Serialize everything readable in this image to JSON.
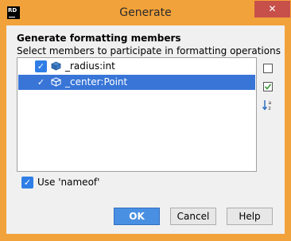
{
  "window": {
    "title": "Generate",
    "app_icon_text": "RD",
    "close_glyph": "✕"
  },
  "dialog": {
    "heading": "Generate formatting members",
    "instruction": "Select members to participate in formatting operations"
  },
  "members": [
    {
      "name": "_radius:int",
      "checked": true,
      "selected": false,
      "icon": "field-icon"
    },
    {
      "name": "_center:Point",
      "checked": true,
      "selected": true,
      "icon": "field-icon"
    }
  ],
  "side_actions": [
    {
      "name": "deselect-all-icon"
    },
    {
      "name": "select-all-icon"
    },
    {
      "name": "sort-alphabetically-icon"
    }
  ],
  "options": {
    "use_nameof_label": "Use 'nameof'",
    "use_nameof_checked": true
  },
  "buttons": {
    "ok": "OK",
    "cancel": "Cancel",
    "help": "Help"
  },
  "colors": {
    "title_bar": "#f2a23a",
    "close_button": "#c7504b",
    "selection": "#3875d7",
    "checkbox": "#2f7ee6",
    "primary_button": "#4a90e2"
  }
}
